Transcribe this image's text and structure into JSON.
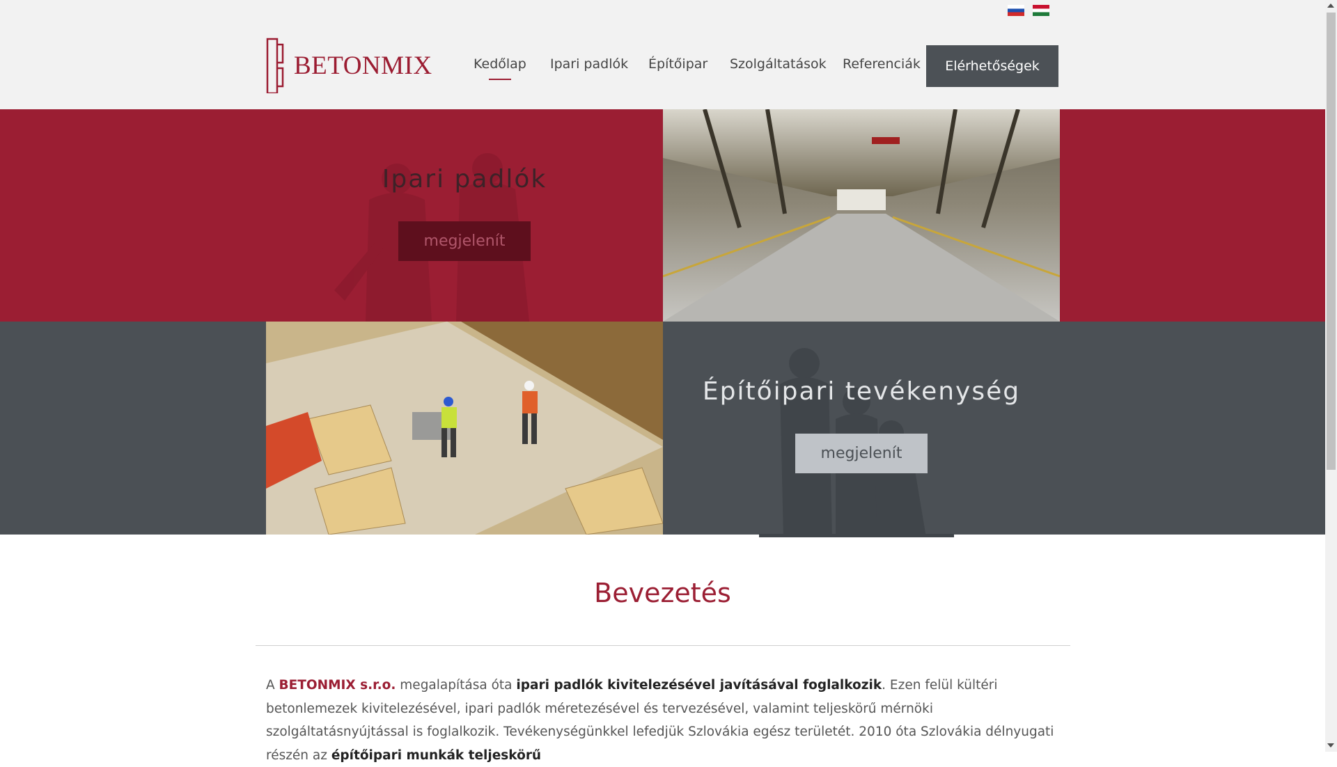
{
  "header": {
    "logo_text": "BETONMIX",
    "flags": [
      "slovak-flag-icon",
      "hungarian-flag-icon"
    ],
    "nav": [
      {
        "label": "Kedőlap",
        "active": true
      },
      {
        "label": "Ipari padlók",
        "active": false
      },
      {
        "label": "Építőipar",
        "active": false
      },
      {
        "label": "Szolgáltatások",
        "active": false
      },
      {
        "label": "Referenciák",
        "active": false
      }
    ],
    "cta_label": "Elérhetőségek"
  },
  "panels": {
    "industrial": {
      "title": "Ipari padlók",
      "button": "megjelenít"
    },
    "construction": {
      "title": "Építőipari tevékenység",
      "button": "megjelenít"
    }
  },
  "intro": {
    "title": "Bevezetés",
    "p1_a": "A ",
    "p1_brand": "BETONMIX s.r.o.",
    "p1_b": " megalapítása óta ",
    "p1_bold": "ipari padlók kivitelezésével javításával foglalkozik",
    "p1_c": ". Ezen felül kültéri betonlemezek kivitelezésével, ipari padlók méretezésével és tervezésével, valamint teljeskörű mérnöki szolgáltatásnyújtással is foglalkozik. Tevékenységünkkel lefedjük Szlovákia egész területét. 2010 óta Szlovákia délnyugati részén az ",
    "p1_bold2": "építőipari munkák teljeskörű"
  },
  "colors": {
    "brand_red": "#9b1e33",
    "dark_gray": "#4b5055",
    "header_bg": "#f2f2f2"
  }
}
